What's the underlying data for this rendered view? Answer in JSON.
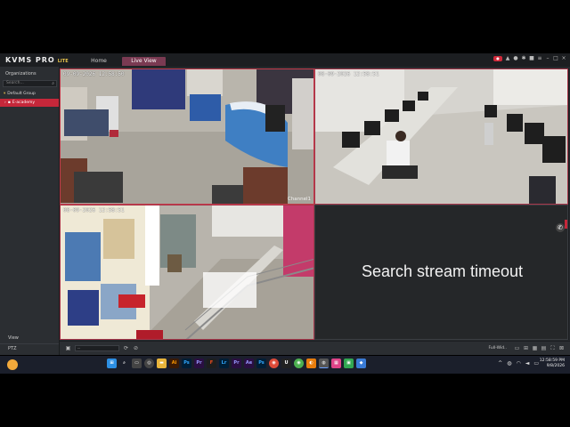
{
  "app": {
    "logo_main": "KVMS PRO",
    "logo_sub": "LITE",
    "nav": {
      "home": "Home",
      "live_view": "Live View"
    },
    "accent_color": "#c5273a"
  },
  "sidebar": {
    "title": "Organizations",
    "search_placeholder": "Search...",
    "group": "Default Group",
    "selected_device": "E-academy",
    "view_label": "View",
    "ptz_label": "PTZ"
  },
  "tiles": [
    {
      "timestamp": "09-09-2026 12:58:50",
      "channel": "Channel1"
    },
    {
      "timestamp": "08-09-2026 12:58:51",
      "channel": ""
    },
    {
      "timestamp": "08-09-2026 12:58:51",
      "channel": ""
    },
    {
      "message": "Search stream timeout"
    }
  ],
  "toolbar": {
    "stream_type": "Full-Wid..",
    "select_value": "--"
  },
  "taskbar": {
    "apps": [
      "Ai",
      "Ps",
      "Pr",
      "Lr",
      "Ae",
      "Ps"
    ],
    "time": "12:58:59 PM",
    "date": "9/8/2026"
  }
}
